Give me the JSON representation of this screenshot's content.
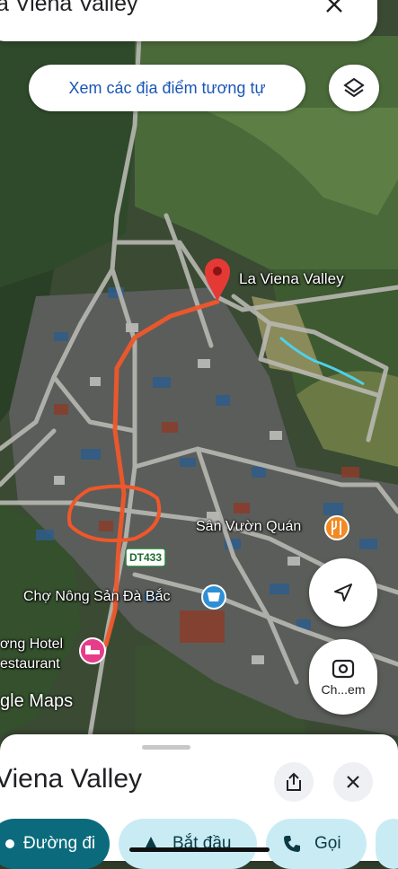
{
  "search": {
    "query": "a Viena Valley"
  },
  "buttons": {
    "similar_places": "Xem các địa điểm tương tự",
    "lens": "Ch...em"
  },
  "map": {
    "place_label": "La Viena Valley",
    "poi_restaurant": "Sân Vườn Quán",
    "poi_market": "Chợ Nông Sản Đà Bắc",
    "poi_hotel_line1": "ơng Hotel",
    "poi_hotel_line2": "estaurant",
    "road_label": "DT433",
    "watermark": "gle Maps"
  },
  "sheet": {
    "title": "Viena Valley"
  },
  "actions": {
    "directions": "Đường đi",
    "start": "Bắt đầu",
    "call": "Gọi"
  },
  "colors": {
    "pin": "#e53935",
    "route": "#f0572a",
    "accent": "#1a56b8",
    "primary_chip": "#0b6b7d",
    "secondary_chip": "#c9ecf4",
    "restaurant_poi": "#f08a24",
    "market_poi": "#2f8fd6",
    "hotel_poi": "#e63d8a"
  }
}
